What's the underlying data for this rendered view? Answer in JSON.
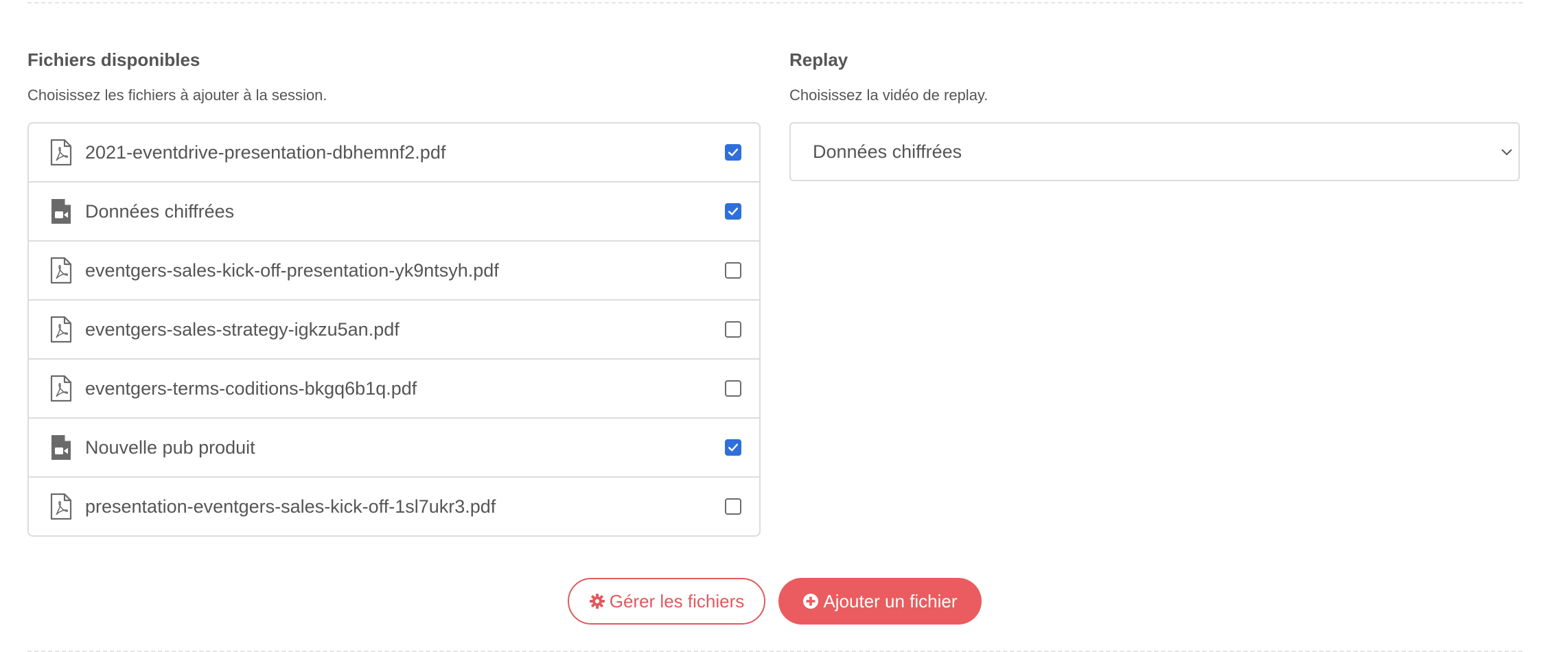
{
  "files_section": {
    "title": "Fichiers disponibles",
    "description": "Choisissez les fichiers à ajouter à la session.",
    "files": [
      {
        "name": "2021-eventdrive-presentation-dbhemnf2.pdf",
        "icon": "file-pdf-icon",
        "checked": true
      },
      {
        "name": "Données chiffrées",
        "icon": "file-video-icon",
        "checked": true
      },
      {
        "name": "eventgers-sales-kick-off-presentation-yk9ntsyh.pdf",
        "icon": "file-pdf-icon",
        "checked": false
      },
      {
        "name": "eventgers-sales-strategy-igkzu5an.pdf",
        "icon": "file-pdf-icon",
        "checked": false
      },
      {
        "name": "eventgers-terms-coditions-bkgq6b1q.pdf",
        "icon": "file-pdf-icon",
        "checked": false
      },
      {
        "name": "Nouvelle pub produit",
        "icon": "file-video-icon",
        "checked": true
      },
      {
        "name": "presentation-eventgers-sales-kick-off-1sl7ukr3.pdf",
        "icon": "file-pdf-icon",
        "checked": false
      }
    ]
  },
  "replay_section": {
    "title": "Replay",
    "description": "Choisissez la vidéo de replay.",
    "selected": "Données chiffrées"
  },
  "actions": {
    "manage_label": "Gérer les fichiers",
    "manage_icon": "gear-icon",
    "add_label": "Ajouter un fichier",
    "add_icon": "plus-circle-icon"
  },
  "colors": {
    "accent": "#ea5c5f",
    "checkbox_checked": "#2f6fdb",
    "border": "#dcdcdc",
    "text": "#555555"
  }
}
